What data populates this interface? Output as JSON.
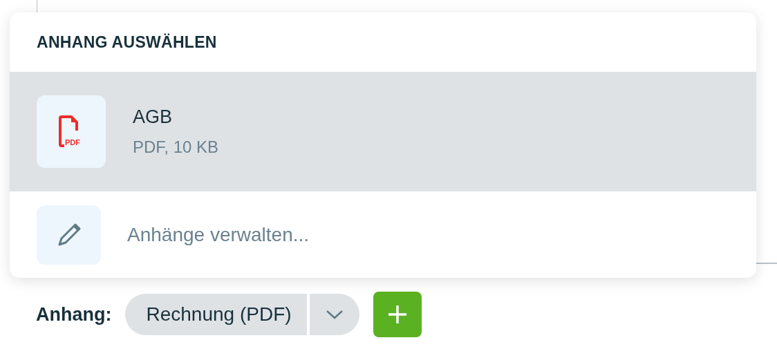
{
  "popup": {
    "title": "ANHANG AUSWÄHLEN",
    "attachments": [
      {
        "kind": "pdf",
        "icon_text": "PDF",
        "name": "AGB",
        "meta": "PDF, 10 KB",
        "selected": true
      }
    ],
    "manage": {
      "label": "Anhänge verwalten..."
    }
  },
  "footer": {
    "label": "Anhang:",
    "select": {
      "value": "Rechnung (PDF)"
    }
  }
}
